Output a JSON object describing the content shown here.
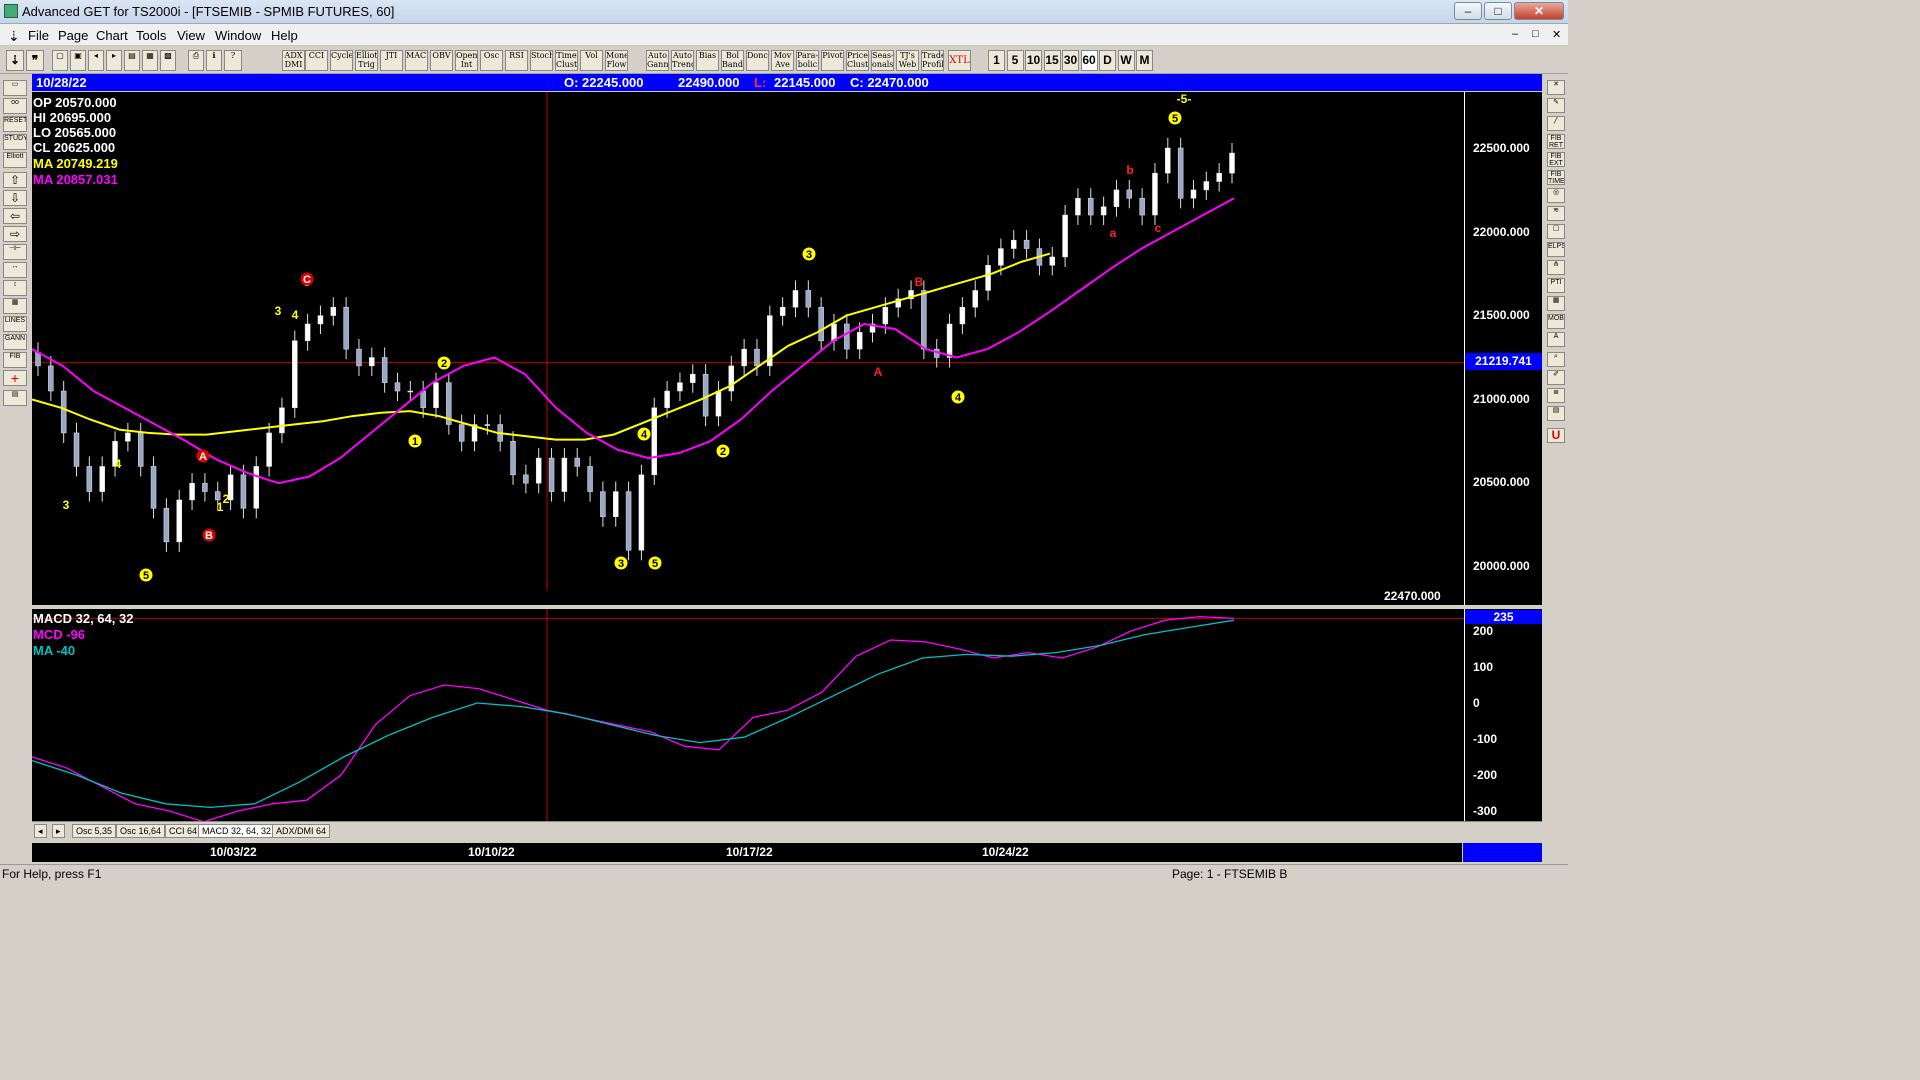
{
  "window": {
    "title": "Advanced GET for TS2000i - [FTSEMIB - SPMIB FUTURES, 60]",
    "buttons": [
      "–",
      "□",
      "✕"
    ],
    "mdi_buttons": [
      "–",
      "□",
      "✕"
    ]
  },
  "menu": [
    "File",
    "Page",
    "Chart",
    "Tools",
    "View",
    "Window",
    "Help"
  ],
  "toolbar": {
    "studies": [
      "ADX DMI",
      "CCI",
      "Cycles",
      "Elliott Trig",
      "JTI",
      "MACD",
      "OBV",
      "Open Int",
      "Osc",
      "RSI",
      "Stoch",
      "Time Clust",
      "Vol",
      "Money Flow",
      "Auto Gann",
      "Auto Trend",
      "Bias",
      "Bol Band",
      "Donch",
      "Mov Ave",
      "Para- bolic",
      "Pivot",
      "Price Clust",
      "Seas- onals",
      "TJ's Web",
      "Trade Profile",
      "XTL"
    ],
    "intervals": [
      "1",
      "5",
      "10",
      "15",
      "30",
      "60",
      "D",
      "W",
      "M"
    ]
  },
  "infobar": {
    "date": "10/28/22",
    "open": "O: 22245.000",
    "high": "22490.000",
    "low_label": "L:",
    "low": "22145.000",
    "close": "C: 22470.000"
  },
  "overlay": {
    "op": "OP  20570.000",
    "hi": "HI   20695.000",
    "lo": "LO  20565.000",
    "cl": "CL  20625.000",
    "ma1": "MA  20749.219",
    "ma2": "MA  20857.031",
    "last_price": "22470.000"
  },
  "price_axis": {
    "labels": [
      "22500.000",
      "22000.000",
      "21500.000",
      "21000.000",
      "20500.000",
      "20000.000"
    ],
    "crosshair_value": "21219.741"
  },
  "macd": {
    "title": "MACD 32, 64, 32",
    "macd_label": "MCD -96",
    "ma_label": "MA   -40",
    "axis_labels": [
      "200",
      "100",
      "0",
      "-100",
      "-200",
      "-300"
    ],
    "current": "235"
  },
  "tabs": [
    "Osc 5,35",
    "Osc 16,64",
    "CCI 64",
    "MACD 32, 64, 32",
    "ADX/DMI 64"
  ],
  "dates": [
    "10/03/22",
    "10/10/22",
    "10/17/22",
    "10/24/22"
  ],
  "status": {
    "help": "For Help, press F1",
    "page": "Page: 1 - FTSEMIB B"
  },
  "colors": {
    "ma_yellow": "#ffff00",
    "ma_magenta": "#ff00ff",
    "macd_line": "#ff00ff",
    "signal_line": "#00c0c0",
    "wave_label": "#ffff00",
    "wave_alt": "#ff2020",
    "crosshair": "#c00000",
    "infobar": "#0000ff"
  },
  "chart_data": {
    "type": "candlestick",
    "symbol": "FTSEMIB - SPMIB FUTURES",
    "interval": "60",
    "ylim": [
      19800,
      22750
    ],
    "close_series": [
      21200,
      21050,
      20800,
      20600,
      20450,
      20600,
      20750,
      20800,
      20600,
      20350,
      20150,
      20400,
      20500,
      20450,
      20400,
      20550,
      20350,
      20600,
      20800,
      20950,
      21350,
      21450,
      21500,
      21550,
      21300,
      21200,
      21250,
      21100,
      21050,
      21050,
      20950,
      21100,
      20850,
      20750,
      20850,
      20850,
      20750,
      20550,
      20500,
      20650,
      20450,
      20650,
      20600,
      20450,
      20300,
      20450,
      20100,
      20550,
      20950,
      21050,
      21100,
      21150,
      20900,
      21050,
      21200,
      21300,
      21200,
      21500,
      21550,
      21650,
      21550,
      21350,
      21450,
      21300,
      21400,
      21450,
      21550,
      21600,
      21650,
      21300,
      21250,
      21450,
      21550,
      21650,
      21800,
      21900,
      21950,
      21900,
      21800,
      21850,
      22100,
      22200,
      22100,
      22150,
      22250,
      22200,
      22100,
      22350,
      22500,
      22200,
      22250,
      22300,
      22350,
      22470
    ],
    "ma_yellow": [
      21000,
      20950,
      20880,
      20820,
      20800,
      20790,
      20790,
      20810,
      20830,
      20850,
      20870,
      20900,
      20920,
      20930,
      20900,
      20850,
      20800,
      20780,
      20760,
      20760,
      20790,
      20860,
      20930,
      21000,
      21080,
      21200,
      21320,
      21400,
      21500,
      21550,
      21600,
      21650,
      21700,
      21750,
      21820,
      21870
    ],
    "ma_magenta": [
      21300,
      21200,
      21050,
      20950,
      20850,
      20750,
      20640,
      20560,
      20500,
      20540,
      20650,
      20800,
      20950,
      21100,
      21200,
      21250,
      21150,
      20950,
      20800,
      20700,
      20650,
      20680,
      20750,
      20880,
      21050,
      21200,
      21350,
      21450,
      21420,
      21300,
      21250,
      21300,
      21400,
      21520,
      21650,
      21780,
      21900,
      22000,
      22100,
      22200
    ],
    "macd": [
      -150,
      -180,
      -230,
      -280,
      -300,
      -330,
      -300,
      -280,
      -270,
      -200,
      -60,
      20,
      50,
      40,
      10,
      -20,
      -40,
      -60,
      -80,
      -120,
      -130,
      -40,
      -20,
      30,
      130,
      175,
      170,
      150,
      125,
      140,
      125,
      155,
      200,
      230,
      240,
      235
    ],
    "signal": [
      -160,
      -200,
      -250,
      -280,
      -290,
      -280,
      -220,
      -150,
      -90,
      -40,
      0,
      -10,
      -30,
      -60,
      -90,
      -110,
      -95,
      -40,
      20,
      80,
      125,
      135,
      130,
      140,
      160,
      190,
      210,
      230
    ],
    "wave_labels": [
      {
        "label": "3",
        "type": "plain"
      },
      {
        "label": "4",
        "type": "plain"
      },
      {
        "label": "5",
        "type": "circled"
      },
      {
        "label": "A",
        "type": "red-circled"
      },
      {
        "label": "B",
        "type": "red-circled"
      },
      {
        "label": "1",
        "type": "plain"
      },
      {
        "label": "2",
        "type": "plain"
      },
      {
        "label": "3",
        "type": "plain"
      },
      {
        "label": "4",
        "type": "plain"
      },
      {
        "label": "5",
        "type": "plain"
      },
      {
        "label": "C",
        "type": "red-circled"
      },
      {
        "label": "2",
        "type": "circled"
      },
      {
        "label": "1",
        "type": "circled"
      },
      {
        "label": "3",
        "type": "circled"
      },
      {
        "label": "4",
        "type": "circled"
      },
      {
        "label": "5",
        "type": "circled"
      },
      {
        "label": "2",
        "type": "circled"
      },
      {
        "label": "3",
        "type": "circled"
      },
      {
        "label": "A",
        "type": "red"
      },
      {
        "label": "B",
        "type": "red"
      },
      {
        "label": "4",
        "type": "circled"
      },
      {
        "label": "a",
        "type": "red"
      },
      {
        "label": "b",
        "type": "red"
      },
      {
        "label": "c",
        "type": "red"
      },
      {
        "label": "-5-",
        "type": "plain"
      },
      {
        "label": "5",
        "type": "circled"
      }
    ]
  }
}
